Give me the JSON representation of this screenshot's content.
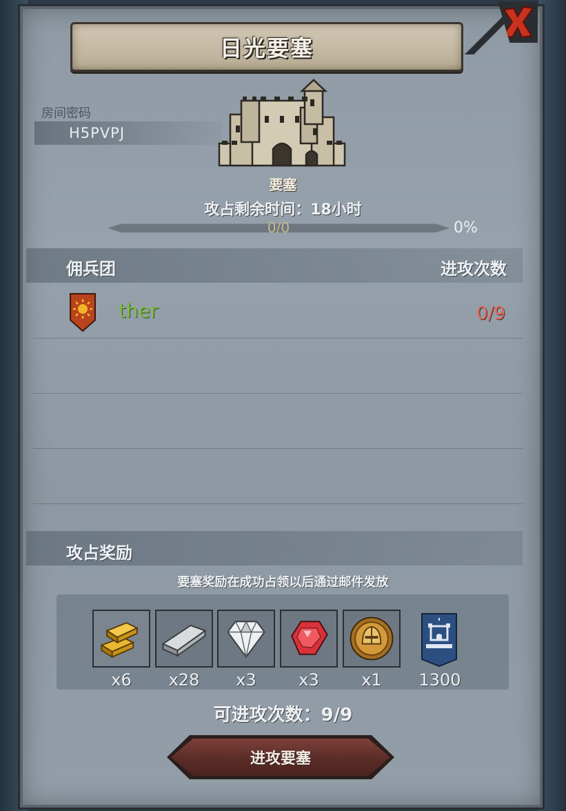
{
  "title": "日光要塞",
  "room": {
    "label": "房间密码",
    "code": "H5PVPJ"
  },
  "fortress": {
    "label": "要塞",
    "time_remaining": "攻占剩余时间：18小时",
    "progress": {
      "current": 0,
      "total": 0,
      "text": "0/0",
      "percent_text": "0%"
    }
  },
  "mercenary_section": {
    "header_left": "佣兵团",
    "header_right": "进攻次数",
    "rows": [
      {
        "name": "ther",
        "attacks": "0/9"
      }
    ]
  },
  "rewards": {
    "header": "攻占奖励",
    "note": "要塞奖励在成功占领以后通过邮件发放",
    "items": [
      {
        "icon": "gold-bars-icon",
        "qty": "x6"
      },
      {
        "icon": "iron-ingot-icon",
        "qty": "x28"
      },
      {
        "icon": "diamond-icon",
        "qty": "x3"
      },
      {
        "icon": "ruby-icon",
        "qty": "x3"
      },
      {
        "icon": "knight-medal-icon",
        "qty": "x1"
      },
      {
        "icon": "fortress-banner-icon",
        "qty": "1300"
      }
    ]
  },
  "attacks_available": "可进攻次数：9/9",
  "attack_button_label": "进攻要塞",
  "colors": {
    "panel": "#939ea8",
    "title_banner": "#c9bea8",
    "mercenary_name": "#7dbb45",
    "attack_count": "#e36a5c",
    "close_x": "#c8321f",
    "button": "#6a342e"
  }
}
